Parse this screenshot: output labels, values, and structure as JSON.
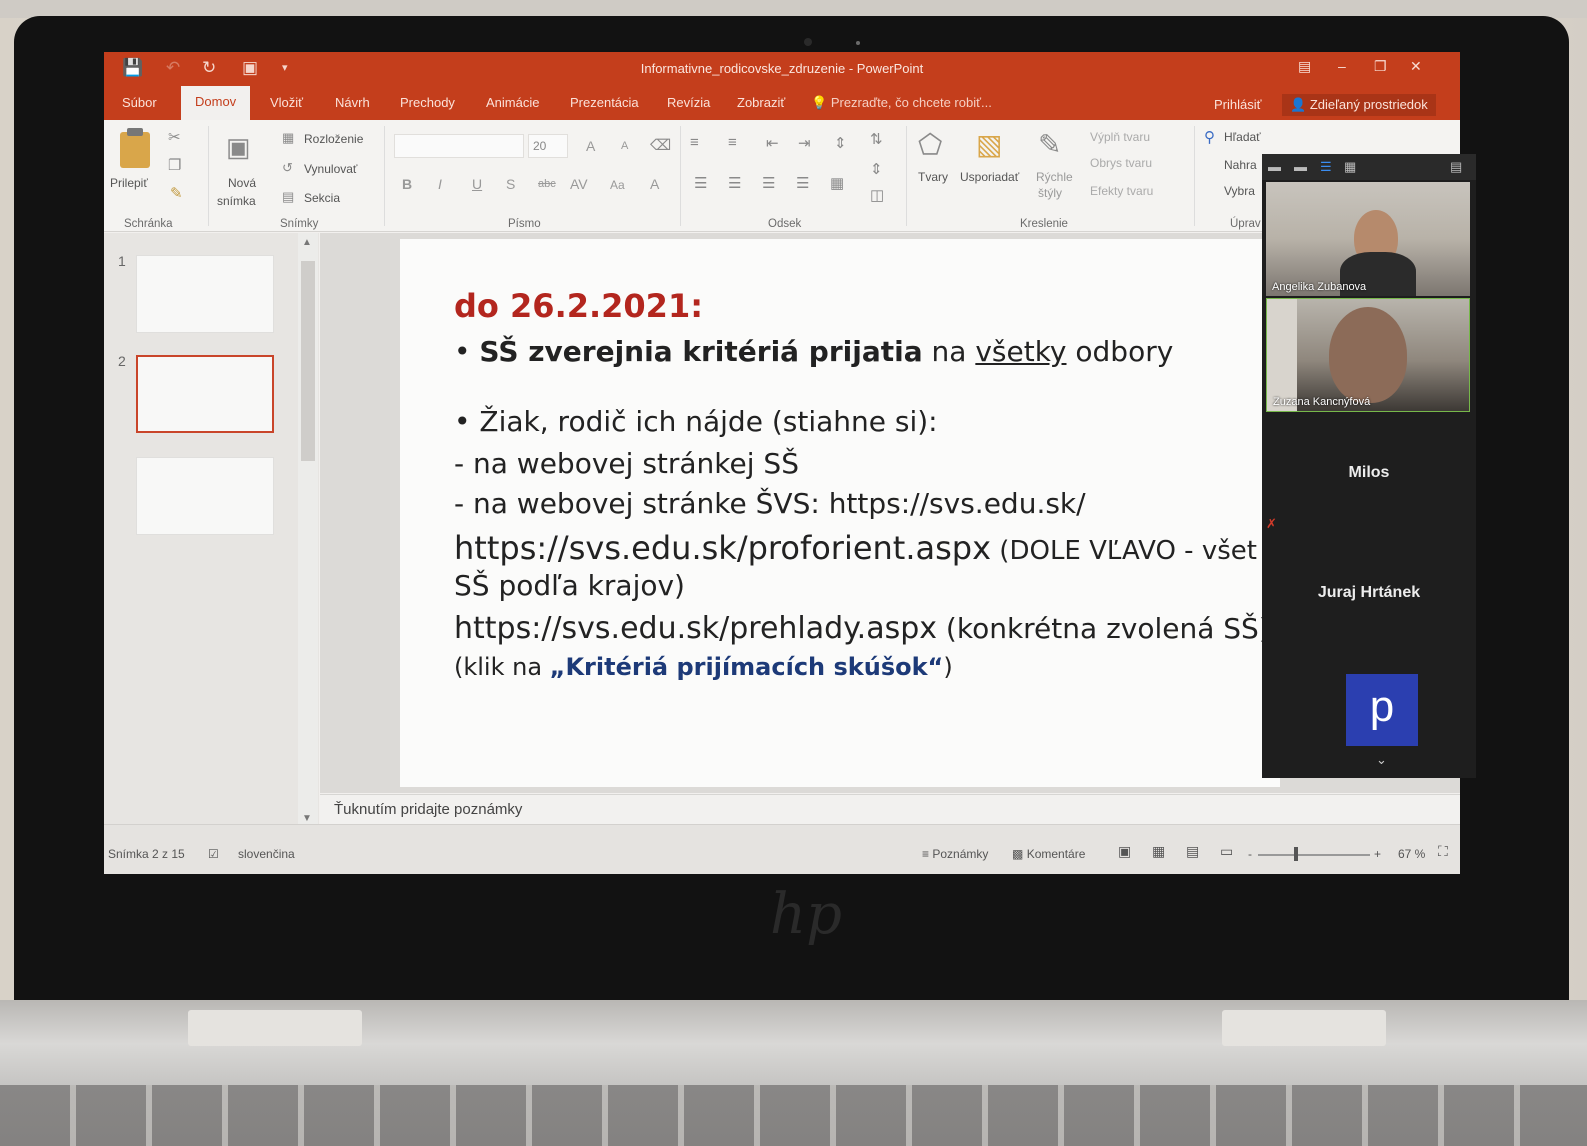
{
  "window": {
    "title": "Informativne_rodicovske_zdruzenie - PowerPoint",
    "controls": [
      "restore-ribbon",
      "minimize",
      "maximize",
      "close"
    ]
  },
  "tabs": {
    "items": [
      "Súbor",
      "Domov",
      "Vložiť",
      "Návrh",
      "Prechody",
      "Animácie",
      "Prezentácia",
      "Revízia",
      "Zobraziť"
    ],
    "active": "Domov",
    "tell_me": "Prezraďte, čo chcete robiť...",
    "sign_in": "Prihlásiť",
    "share": "Zdieľaný prostriedok"
  },
  "ribbon": {
    "clipboard": {
      "paste": "Prilepiť",
      "group": "Schránka"
    },
    "slides": {
      "new_slide_1": "Nová",
      "new_slide_2": "snímka",
      "layout": "Rozloženie",
      "reset": "Vynulovať",
      "section": "Sekcia",
      "group": "Snímky"
    },
    "font": {
      "size": "20",
      "group": "Písmo",
      "bold": "B",
      "italic": "I",
      "underline": "U",
      "shadow": "S",
      "strike": "abc",
      "spacing": "AV",
      "case": "Aa",
      "color": "A",
      "grow": "A",
      "shrink": "A"
    },
    "paragraph": {
      "group": "Odsek"
    },
    "drawing": {
      "shapes": "Tvary",
      "arrange": "Usporiadať",
      "quick_1": "Rýchle",
      "quick_2": "štýly",
      "fill": "Výplň tvaru",
      "outline": "Obrys tvaru",
      "effects": "Efekty tvaru",
      "group": "Kreslenie"
    },
    "editing": {
      "find": "Hľadať",
      "replace": "Nahra",
      "select": "Vybra",
      "group": "Úprav"
    }
  },
  "thumbnails": {
    "numbers": [
      "1",
      "2"
    ],
    "selected": 2
  },
  "slide": {
    "heading": "do 26.2.2021:",
    "bullet1_bold": "SŠ zverejnia kritériá prijatia",
    "bullet1_mid": " na ",
    "bullet1_ul": "všetky",
    "bullet1_end": " odbory",
    "bullet2": "Žiak, rodič ich nájde (stiahne si):",
    "line_web_ss": "- na webovej stránkej SŠ",
    "line_web_svs": "- na webovej stránke ŠVS: ",
    "link_svs": "https://svs.edu.sk/",
    "link_proforient": "https://svs.edu.sk/proforient.aspx",
    "proforient_note": " (DOLE VĽAVO - všet",
    "line_ss_kraje": "SŠ podľa krajov)",
    "link_prehlady": "https://svs.edu.sk/prehlady.aspx",
    "prehlady_note": " (konkrétna zvolená SŠ)",
    "click_pre": "(klik na ",
    "click_bold": "„Kritériá prijímacích skúšok“",
    "click_post": ")"
  },
  "notes_placeholder": "Ťuknutím pridajte poznámky",
  "status": {
    "slide_count": "Snímka 2 z 15",
    "language": "slovenčina",
    "notes": "Poznámky",
    "comments": "Komentáre",
    "zoom_minus": "-",
    "zoom_plus": "+",
    "zoom_level": "67 %"
  },
  "call": {
    "participants": [
      "Angelika Zubanova",
      "Zuzana Kancnýfová",
      "Milos",
      "Juraj Hrtánek"
    ],
    "avatar_letter": "p"
  }
}
